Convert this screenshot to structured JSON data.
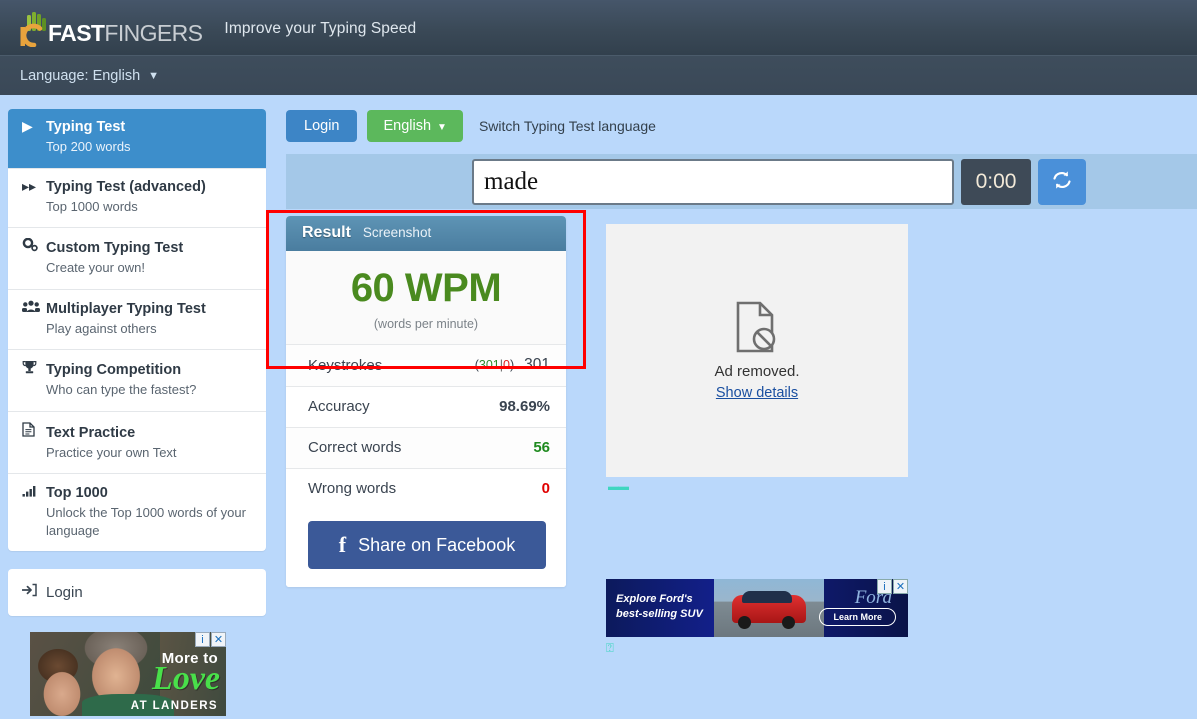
{
  "header": {
    "logo_text_bold": "FAST",
    "logo_text_light": "FINGERS",
    "tagline": "Improve your Typing Speed",
    "language_label": "Language: English",
    "caret_icon": "chevron-down-icon"
  },
  "sidebar": {
    "items": [
      {
        "icon": "play-icon",
        "title": "Typing Test",
        "subtitle": "Top 200 words",
        "active": true
      },
      {
        "icon": "forward-icon",
        "title": "Typing Test (advanced)",
        "subtitle": "Top 1000 words",
        "active": false
      },
      {
        "icon": "gears-icon",
        "title": "Custom Typing Test",
        "subtitle": "Create your own!",
        "active": false
      },
      {
        "icon": "users-icon",
        "title": "Multiplayer Typing Test",
        "subtitle": "Play against others",
        "active": false
      },
      {
        "icon": "trophy-icon",
        "title": "Typing Competition",
        "subtitle": "Who can type the fastest?",
        "active": false
      },
      {
        "icon": "document-icon",
        "title": "Text Practice",
        "subtitle": "Practice your own Text",
        "active": false
      },
      {
        "icon": "bar-chart-icon",
        "title": "Top 1000",
        "subtitle": "Unlock the Top 1000 words of your language",
        "active": false
      }
    ],
    "login": {
      "icon": "sign-in-icon",
      "label": "Login"
    },
    "ad": {
      "line1": "More to",
      "line2": "Love",
      "line3": "AT LANDERS",
      "info_badge": "i",
      "close_badge": "✕"
    }
  },
  "toolbar": {
    "login_label": "Login",
    "language_label": "English",
    "language_caret_icon": "caret-down-icon",
    "switch_note": "Switch Typing Test language"
  },
  "typing": {
    "input_value": "made",
    "input_placeholder": "",
    "timer": "0:00",
    "refresh_icon": "refresh-icon"
  },
  "result": {
    "header_title": "Result",
    "header_sub": "Screenshot",
    "wpm_value": "60 WPM",
    "wpm_caption": "(words per minute)",
    "stats": [
      {
        "label": "Keystrokes",
        "correct": "301",
        "separator": "|",
        "wrong": "0",
        "value": "301",
        "value_color": "#3a4450"
      },
      {
        "label": "Accuracy",
        "value": "98.69%",
        "value_color": "#2f3a45"
      },
      {
        "label": "Correct words",
        "value": "56",
        "value_color": "#1f8a1f"
      },
      {
        "label": "Wrong words",
        "value": "0",
        "value_color": "#e00000"
      }
    ],
    "facebook_button": "Share on Facebook",
    "facebook_icon": "facebook-f-icon",
    "highlight_color": "#ff0000"
  },
  "ads": {
    "placeholder": {
      "icon": "document-blocked-icon",
      "text": "Ad removed.",
      "link": "Show details",
      "artifact_glyph": "▬▬"
    },
    "banner": {
      "line1": "Explore Ford's",
      "line2": "best-selling SUV",
      "brand": "Ford",
      "cta": "Learn More",
      "info_badge": "i",
      "close_badge": "✕",
      "artifact_glyph": "⍰"
    }
  },
  "colors": {
    "page_bg": "#bad8fb",
    "header_bg": "#3a4957",
    "accent_blue": "#3d8ecb",
    "green": "#5cb85c",
    "wpm_green": "#4a8a1f",
    "facebook_blue": "#3b5998"
  }
}
